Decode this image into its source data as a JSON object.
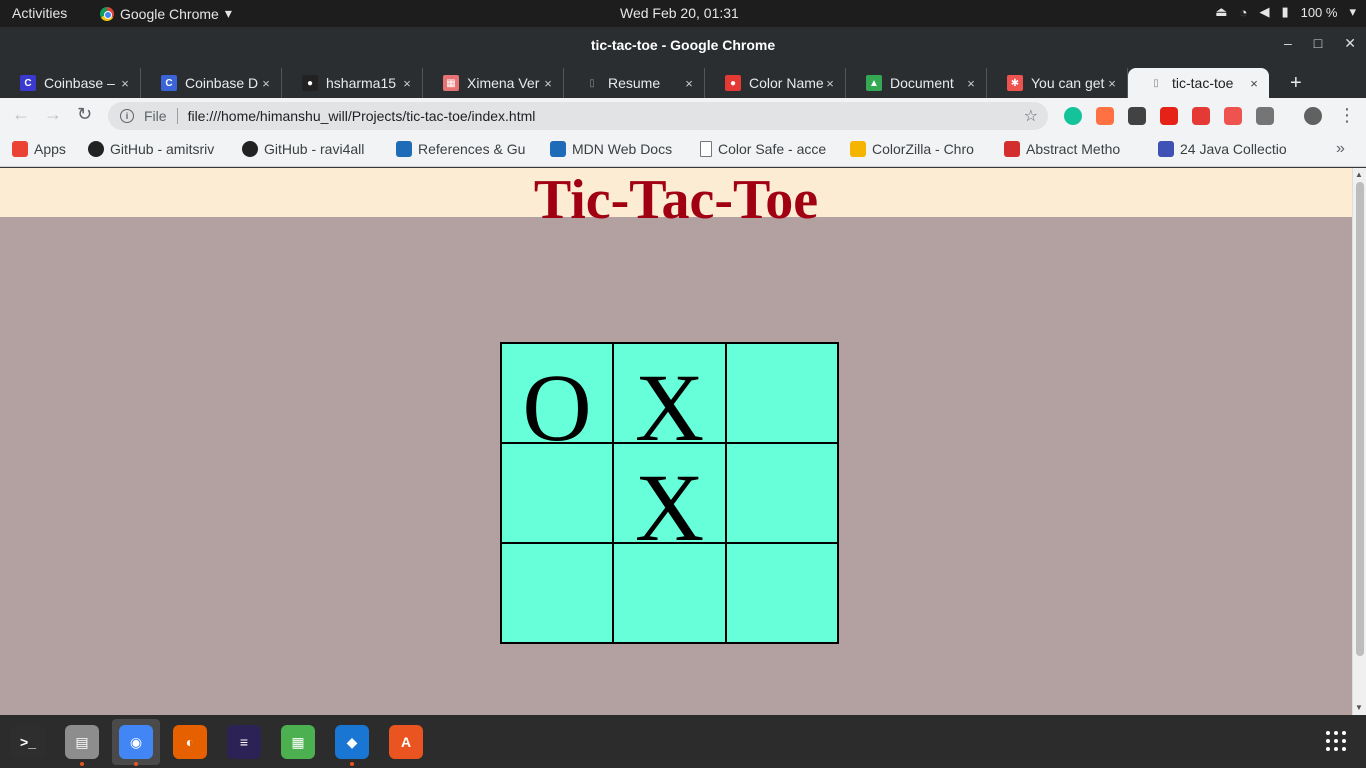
{
  "system_bar": {
    "activities": "Activities",
    "app_name": "Google Chrome",
    "clock": "Wed Feb 20, 01:31",
    "battery": "100 %"
  },
  "window": {
    "title": "tic-tac-toe - Google Chrome",
    "min_symbol": "–",
    "max_symbol": "□",
    "close_symbol": "✕"
  },
  "tabs": [
    {
      "label": "Coinbase – ",
      "favicon": "coinbase-icon",
      "color": "#3a3ad0",
      "glyph": "C"
    },
    {
      "label": "Coinbase D",
      "favicon": "coinbase-icon",
      "color": "#3b64d8",
      "glyph": "C"
    },
    {
      "label": "hsharma15",
      "favicon": "github-icon",
      "color": "#222222",
      "glyph": "●"
    },
    {
      "label": "Ximena Ver",
      "favicon": "ximena-icon",
      "color": "#e57373",
      "glyph": "▦"
    },
    {
      "label": "Resume",
      "favicon": "document-icon",
      "color": "#ffffff",
      "glyph": "▯"
    },
    {
      "label": "Color Name",
      "favicon": "color-name-icon",
      "color": "#e53935",
      "glyph": "●"
    },
    {
      "label": "Document",
      "favicon": "google-drive-icon",
      "color": "#34a853",
      "glyph": "▲"
    },
    {
      "label": "You can get",
      "favicon": "you-can-get-icon",
      "color": "#ef5350",
      "glyph": "✱"
    },
    {
      "label": "tic-tac-toe",
      "favicon": "document-icon",
      "color": "#ffffff",
      "glyph": "▯",
      "active": true
    }
  ],
  "tab_close": "×",
  "new_tab": "+",
  "address": {
    "scheme": "File",
    "url": "file:///home/himanshu_will/Projects/tic-tac-toe/index.html",
    "info_glyph": "i"
  },
  "nav": {
    "back": "←",
    "forward": "→",
    "reload": "↻",
    "star": "☆",
    "menu": "⋮"
  },
  "extensions": [
    {
      "name": "grammarly-extension-icon",
      "color": "#15c39a"
    },
    {
      "name": "fire-extension-icon",
      "color": "#ff7043"
    },
    {
      "name": "camera-extension-icon",
      "color": "#424242"
    },
    {
      "name": "youtube-extension-icon",
      "color": "#e62117"
    },
    {
      "name": "adblock-extension-icon",
      "color": "#e53935"
    },
    {
      "name": "picker-extension-icon",
      "color": "#ef5350"
    },
    {
      "name": "screenshot-extension-icon",
      "color": "#757575"
    },
    {
      "name": "profile-avatar-icon",
      "color": "#616161"
    }
  ],
  "bookmarks": [
    {
      "label": "Apps",
      "icon": "apps-grid-icon",
      "color": "#ea4335"
    },
    {
      "label": "GitHub - amitsriv",
      "icon": "github-icon",
      "color": "#222222"
    },
    {
      "label": "GitHub - ravi4all",
      "icon": "github-icon",
      "color": "#222222"
    },
    {
      "label": "References & Gu",
      "icon": "mdn-icon",
      "color": "#1e6bb8"
    },
    {
      "label": "MDN Web Docs",
      "icon": "mdn-icon",
      "color": "#1e6bb8"
    },
    {
      "label": "Color Safe - acce",
      "icon": "page-icon",
      "color": "#ffffff"
    },
    {
      "label": "ColorZilla - Chro",
      "icon": "colorzilla-icon",
      "color": "#f4b400"
    },
    {
      "label": "Abstract Metho",
      "icon": "oracle-icon",
      "color": "#d32f2f"
    },
    {
      "label": "24 Java Collectio",
      "icon": "d-icon",
      "color": "#3f51b5"
    }
  ],
  "bookmarks_more": "»",
  "page": {
    "title": "Tic-Tac-Toe",
    "header_bg": "#fbecd3",
    "page_bg": "#b3a1a1",
    "title_color": "#a00012",
    "cell_color": "#66ffd9",
    "board": [
      "O",
      "X",
      "",
      "",
      "X",
      "",
      "",
      "",
      ""
    ]
  },
  "dock": [
    {
      "name": "terminal-icon",
      "color": "#2e2e2e",
      "glyph": ">_",
      "running": false
    },
    {
      "name": "files-icon",
      "color": "#8d8d8d",
      "glyph": "▤",
      "running": true
    },
    {
      "name": "chrome-icon",
      "color": "#4285f4",
      "glyph": "◉",
      "running": true,
      "active": true
    },
    {
      "name": "firefox-icon",
      "color": "#e66000",
      "glyph": "◐",
      "running": false
    },
    {
      "name": "eclipse-icon",
      "color": "#2c2255",
      "glyph": "≡",
      "running": false
    },
    {
      "name": "windows-app-icon",
      "color": "#4caf50",
      "glyph": "▦",
      "running": false
    },
    {
      "name": "vscode-icon",
      "color": "#1976d2",
      "glyph": "◆",
      "running": true
    },
    {
      "name": "software-center-icon",
      "color": "#e95420",
      "glyph": "A",
      "running": false
    }
  ]
}
